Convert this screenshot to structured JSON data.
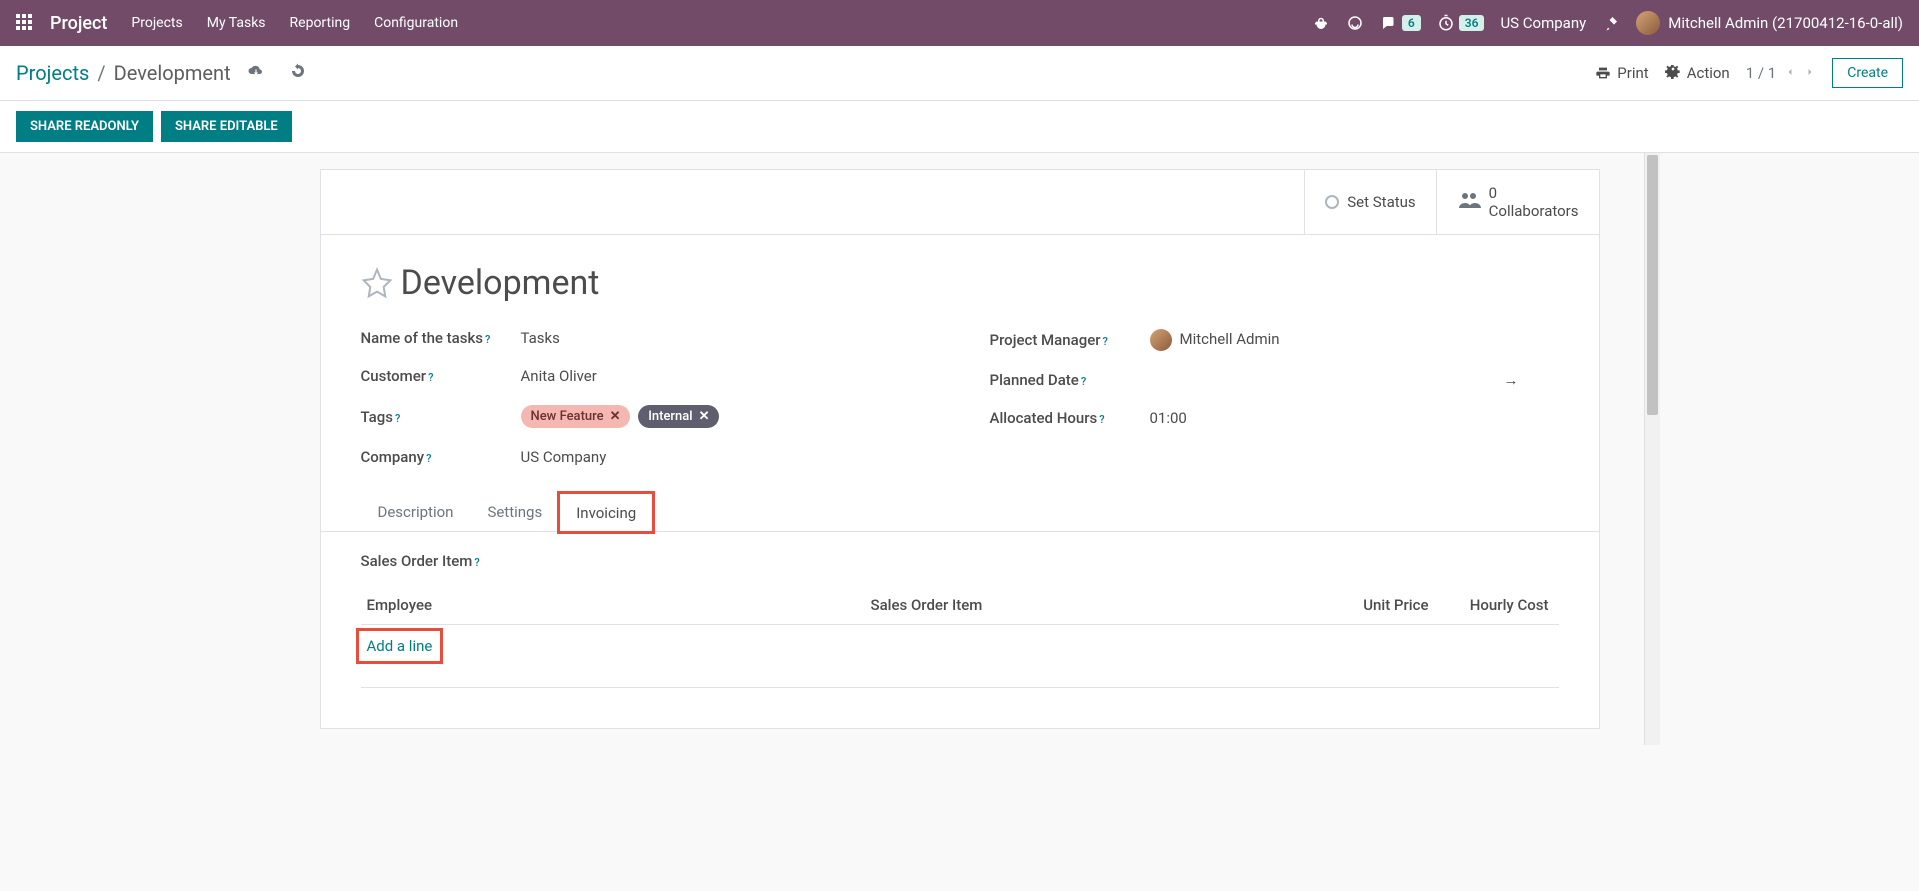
{
  "navbar": {
    "brand": "Project",
    "menu": [
      "Projects",
      "My Tasks",
      "Reporting",
      "Configuration"
    ],
    "chat_badge": "6",
    "timer_badge": "36",
    "company": "US Company",
    "user": "Mitchell Admin (21700412-16-0-all)"
  },
  "breadcrumb": {
    "root": "Projects",
    "current": "Development"
  },
  "cp": {
    "print": "Print",
    "action": "Action",
    "pager": "1 / 1",
    "create": "Create"
  },
  "share": {
    "readonly": "SHARE READONLY",
    "editable": "SHARE EDITABLE"
  },
  "status": {
    "set_status": "Set Status",
    "collab_count": "0",
    "collab_label": "Collaborators"
  },
  "title": "Development",
  "fields": {
    "name_of_tasks_label": "Name of the tasks",
    "name_of_tasks_value": "Tasks",
    "customer_label": "Customer",
    "customer_value": "Anita Oliver",
    "tags_label": "Tags",
    "tags": [
      {
        "name": "New Feature",
        "cls": "tag-pink"
      },
      {
        "name": "Internal",
        "cls": "tag-gray"
      }
    ],
    "company_label": "Company",
    "company_value": "US Company",
    "pm_label": "Project Manager",
    "pm_value": "Mitchell Admin",
    "planned_label": "Planned Date",
    "planned_arrow": "→",
    "hours_label": "Allocated Hours",
    "hours_value": "01:00"
  },
  "tabs": [
    "Description",
    "Settings",
    "Invoicing"
  ],
  "soi": {
    "label": "Sales Order Item",
    "th_employee": "Employee",
    "th_soi": "Sales Order Item",
    "th_unit_price": "Unit Price",
    "th_hourly_cost": "Hourly Cost",
    "add_line": "Add a line"
  }
}
